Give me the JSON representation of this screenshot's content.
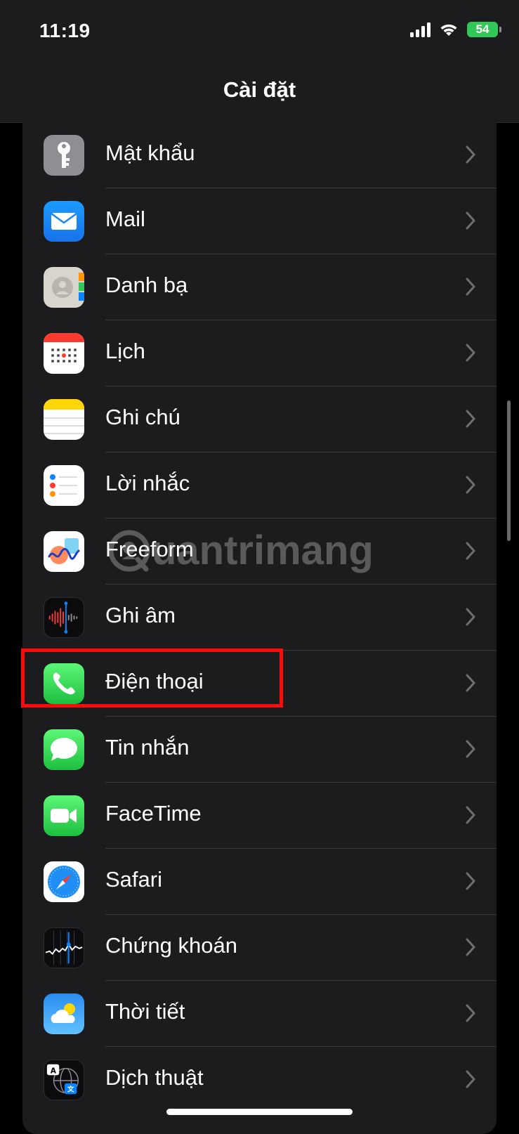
{
  "status_bar": {
    "time": "11:19",
    "battery": "54"
  },
  "nav": {
    "title": "Cài đặt"
  },
  "colors": {
    "background": "#000000",
    "group": "#1c1c1e",
    "separator": "#38383a",
    "highlight": "#ff0a0a"
  },
  "settings": [
    {
      "label": "Mật khẩu",
      "icon": "key-icon"
    },
    {
      "label": "Mail",
      "icon": "mail-icon"
    },
    {
      "label": "Danh bạ",
      "icon": "contacts-icon"
    },
    {
      "label": "Lịch",
      "icon": "calendar-icon"
    },
    {
      "label": "Ghi chú",
      "icon": "notes-icon"
    },
    {
      "label": "Lời nhắc",
      "icon": "reminders-icon"
    },
    {
      "label": "Freeform",
      "icon": "freeform-icon"
    },
    {
      "label": "Ghi âm",
      "icon": "voice-memos-icon"
    },
    {
      "label": "Điện thoại",
      "icon": "phone-icon"
    },
    {
      "label": "Tin nhắn",
      "icon": "messages-icon"
    },
    {
      "label": "FaceTime",
      "icon": "facetime-icon"
    },
    {
      "label": "Safari",
      "icon": "safari-icon"
    },
    {
      "label": "Chứng khoán",
      "icon": "stocks-icon"
    },
    {
      "label": "Thời tiết",
      "icon": "weather-icon"
    },
    {
      "label": "Dịch thuật",
      "icon": "translate-icon"
    }
  ],
  "watermark": {
    "text": "uantrimang"
  }
}
